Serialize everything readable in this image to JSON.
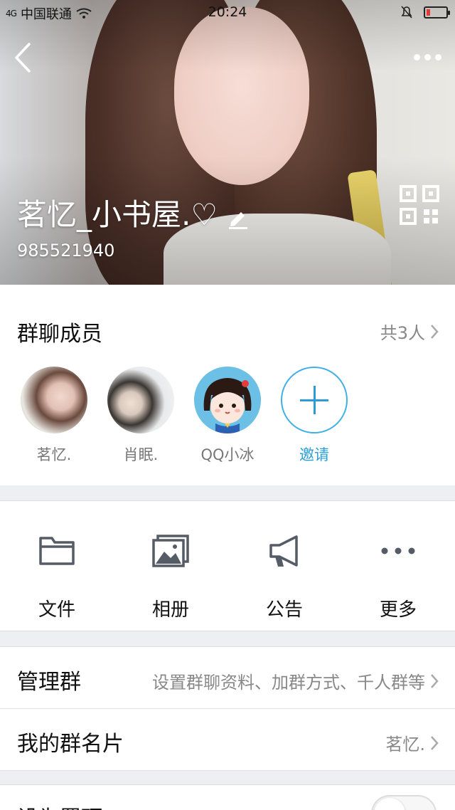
{
  "status_bar": {
    "signal": "4G",
    "carrier": "中国联通",
    "time": "20:24"
  },
  "header": {
    "group_name": "茗忆_小书屋.♡",
    "group_id": "985521940",
    "icons": [
      "back-icon",
      "more-icon",
      "edit-icon",
      "qr-code-icon"
    ]
  },
  "members": {
    "title": "群聊成员",
    "count_label": "共3人",
    "list": [
      {
        "name": "茗忆."
      },
      {
        "name": "肖眠."
      },
      {
        "name": "QQ小冰"
      }
    ],
    "invite_label": "邀请"
  },
  "tools": [
    {
      "label": "文件",
      "icon": "folder-icon"
    },
    {
      "label": "相册",
      "icon": "album-icon"
    },
    {
      "label": "公告",
      "icon": "megaphone-icon"
    },
    {
      "label": "更多",
      "icon": "more-dots-icon"
    }
  ],
  "rows": [
    {
      "label": "管理群",
      "value": "设置群聊资料、加群方式、千人群等"
    },
    {
      "label": "我的群名片",
      "value": "茗忆."
    }
  ],
  "partial_row": {
    "label": "设为置顶",
    "toggle_on": false
  },
  "colors": {
    "accent": "#2a9fd8",
    "battery_low": "#e53935"
  }
}
